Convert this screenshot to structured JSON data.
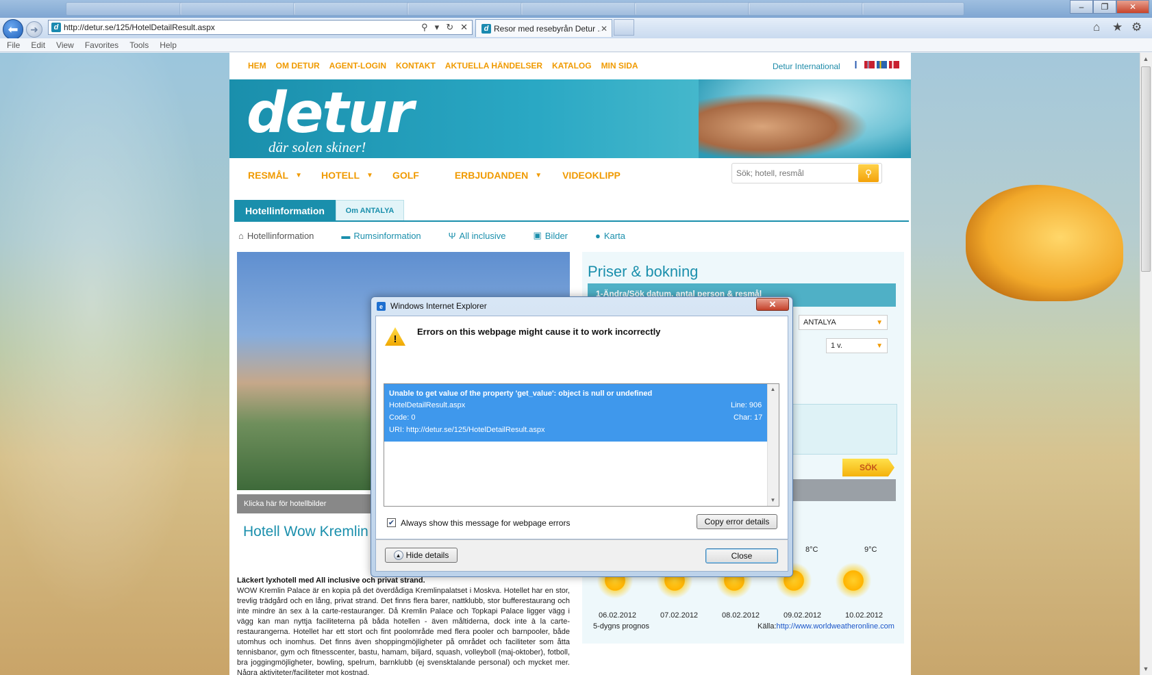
{
  "browser": {
    "url": "http://detur.se/125/HotelDetailResult.aspx",
    "active_tab_title": "Resor med resebyrån Detur ...",
    "menu": [
      "File",
      "Edit",
      "View",
      "Favorites",
      "Tools",
      "Help"
    ],
    "window_buttons": [
      "minimize",
      "restore",
      "close"
    ]
  },
  "site": {
    "top_nav": [
      "HEM",
      "OM DETUR",
      "AGENT-LOGIN",
      "KONTAKT",
      "AKTUELLA HÄNDELSER",
      "KATALOG",
      "MIN SIDA"
    ],
    "intl_link": "Detur International",
    "logo_text": "detur",
    "tagline": "där solen skiner!",
    "main_nav": [
      {
        "label": "RESMÅL",
        "has_dropdown": true
      },
      {
        "label": "HOTELL",
        "has_dropdown": true
      },
      {
        "label": "GOLF",
        "has_dropdown": false
      },
      {
        "label": "ERBJUDANDEN",
        "has_dropdown": true
      },
      {
        "label": "VIDEOKLIPP",
        "has_dropdown": false
      }
    ],
    "search_placeholder": "Sök; hotell, resmål",
    "tabs": [
      "Hotellinformation",
      "Om ANTALYA"
    ],
    "sub_tabs": [
      "Hotellinformation",
      "Rumsinformation",
      "All inclusive",
      "Bilder",
      "Karta"
    ],
    "image_caption": "Klicka här för hotellbilder",
    "hotel_title": "Hotell Wow Kremlin",
    "desc_heading": "Läckert lyxhotell med All inclusive och privat strand.",
    "description": "WOW Kremlin Palace är en kopia på det överdådiga Kremlinpalatset i Moskva. Hotellet har en stor, trevlig trädgård och en lång, privat strand. Det finns flera barer, nattklubb, stor bufferestaurang och inte mindre än sex à la carte-restauranger. Då Kremlin Palace och Topkapi Palace ligger vägg i vägg kan man nyttja faciliteterna på båda hotellen - även måltiderna, dock inte à la carte-restaurangerna. Hotellet har ett stort och fint poolområde med flera pooler och barnpooler, både utomhus och inomhus. Det finns även shoppingmöjligheter på området och faciliteter som åtta tennisbanor, gym och fitnesscenter, bastu, hamam, biljard, squash, volleyboll (maj-oktober), fotboll, bra joggingmöjligheter, bowling, spelrum, barnklubb (ej svensktalande personal) och mycket mer. Några aktiviteter/faciliteter mot kostnad.",
    "price_title": "Priser & bokning",
    "price_step": "1-Ändra/Sök datum, antal person & resmål",
    "destination_value": "ANTALYA",
    "weeks_value": "1  v.",
    "search_button": "SÖK",
    "weather": {
      "temps": [
        "8°C",
        "9°C"
      ],
      "dates": [
        "06.02.2012",
        "07.02.2012",
        "08.02.2012",
        "09.02.2012",
        "10.02.2012"
      ],
      "forecast_label": "5-dygns prognos",
      "source_label": "Källa:",
      "source_url": "http://www.worldweatheronline.com"
    }
  },
  "dialog": {
    "title": "Windows Internet Explorer",
    "heading": "Errors on this webpage might cause it to work incorrectly",
    "error_message": "Unable to get value of the property 'get_value': object is null or undefined",
    "error_file": "HotelDetailResult.aspx",
    "error_line": "Line: 906",
    "error_code": "Code: 0",
    "error_char": "Char: 17",
    "error_uri": "URI: http://detur.se/125/HotelDetailResult.aspx",
    "checkbox_label": "Always show this message for webpage errors",
    "checkbox_checked": true,
    "copy_button": "Copy error details",
    "hide_button": "Hide details",
    "close_button": "Close"
  }
}
